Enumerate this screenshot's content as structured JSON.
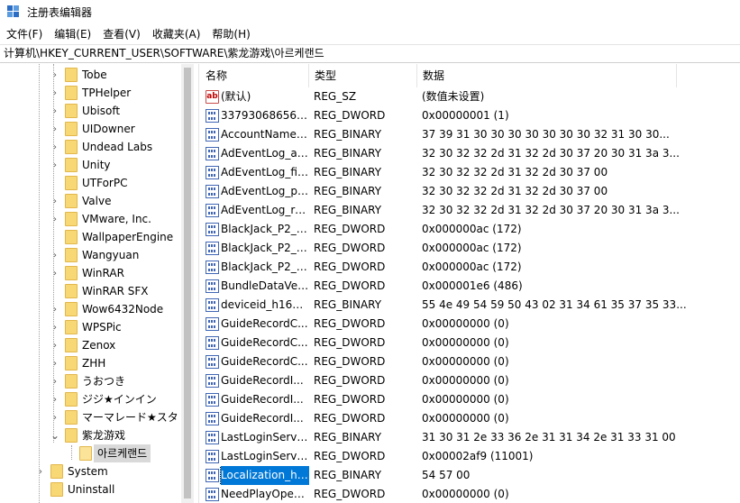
{
  "window": {
    "title": "注册表编辑器",
    "icon_name": "registry-editor-icon"
  },
  "menu": {
    "items": [
      "文件(F)",
      "编辑(E)",
      "查看(V)",
      "收藏夹(A)",
      "帮助(H)"
    ]
  },
  "address": {
    "path": "计算机\\HKEY_CURRENT_USER\\SOFTWARE\\紫龙游戏\\아르케랜드"
  },
  "tree": {
    "items": [
      {
        "label": "Tobe",
        "level": 3,
        "expandable": true
      },
      {
        "label": "TPHelper",
        "level": 3,
        "expandable": true
      },
      {
        "label": "Ubisoft",
        "level": 3,
        "expandable": true
      },
      {
        "label": "UIDowner",
        "level": 3,
        "expandable": true
      },
      {
        "label": "Undead Labs",
        "level": 3,
        "expandable": true
      },
      {
        "label": "Unity",
        "level": 3,
        "expandable": true
      },
      {
        "label": "UTForPC",
        "level": 3,
        "expandable": false
      },
      {
        "label": "Valve",
        "level": 3,
        "expandable": true
      },
      {
        "label": "VMware, Inc.",
        "level": 3,
        "expandable": true
      },
      {
        "label": "WallpaperEngine",
        "level": 3,
        "expandable": false
      },
      {
        "label": "Wangyuan",
        "level": 3,
        "expandable": true
      },
      {
        "label": "WinRAR",
        "level": 3,
        "expandable": true
      },
      {
        "label": "WinRAR SFX",
        "level": 3,
        "expandable": false
      },
      {
        "label": "Wow6432Node",
        "level": 3,
        "expandable": true
      },
      {
        "label": "WPSPic",
        "level": 3,
        "expandable": true
      },
      {
        "label": "Zenox",
        "level": 3,
        "expandable": true
      },
      {
        "label": "ZHH",
        "level": 3,
        "expandable": true
      },
      {
        "label": "うおつき",
        "level": 3,
        "expandable": true
      },
      {
        "label": "ジジ★インイン",
        "level": 3,
        "expandable": true
      },
      {
        "label": "マーマレード★スタ",
        "level": 3,
        "expandable": true
      },
      {
        "label": "紫龙游戏",
        "level": 3,
        "expandable": true,
        "expanded": true
      },
      {
        "label": "아르케랜드",
        "level": 4,
        "expandable": false,
        "selected": true
      },
      {
        "label": "System",
        "level": 2,
        "expandable": true
      },
      {
        "label": "Uninstall",
        "level": 2,
        "expandable": false
      }
    ]
  },
  "list": {
    "columns": [
      "名称",
      "类型",
      "数据"
    ],
    "rows": [
      {
        "name": "(默认)",
        "type": "REG_SZ",
        "data": "(数值未设置)",
        "icon": "string-value-icon"
      },
      {
        "name": "337930686562...",
        "type": "REG_DWORD",
        "data": "0x00000001 (1)",
        "icon": "binary-value-icon"
      },
      {
        "name": "AccountName_...",
        "type": "REG_BINARY",
        "data": "37 39 31 30 30 30 30 30 30 30 32 31 30 30...",
        "icon": "binary-value-icon"
      },
      {
        "name": "AdEventLog_ac...",
        "type": "REG_BINARY",
        "data": "32 30 32 32 2d 31 32 2d 30 37 20 30 31 3a 3...",
        "icon": "binary-value-icon"
      },
      {
        "name": "AdEventLog_fir...",
        "type": "REG_BINARY",
        "data": "32 30 32 32 2d 31 32 2d 30 37 00",
        "icon": "binary-value-icon"
      },
      {
        "name": "AdEventLog_pr...",
        "type": "REG_BINARY",
        "data": "32 30 32 32 2d 31 32 2d 30 37 00",
        "icon": "binary-value-icon"
      },
      {
        "name": "AdEventLog_re...",
        "type": "REG_BINARY",
        "data": "32 30 32 32 2d 31 32 2d 30 37 20 30 31 3a 3...",
        "icon": "binary-value-icon"
      },
      {
        "name": "BlackJack_P2_3...",
        "type": "REG_DWORD",
        "data": "0x000000ac (172)",
        "icon": "binary-value-icon"
      },
      {
        "name": "BlackJack_P2_3...",
        "type": "REG_DWORD",
        "data": "0x000000ac (172)",
        "icon": "binary-value-icon"
      },
      {
        "name": "BlackJack_P2_3...",
        "type": "REG_DWORD",
        "data": "0x000000ac (172)",
        "icon": "binary-value-icon"
      },
      {
        "name": "BundleDataVer...",
        "type": "REG_DWORD",
        "data": "0x000001e6 (486)",
        "icon": "binary-value-icon"
      },
      {
        "name": "deviceid_h160...",
        "type": "REG_BINARY",
        "data": "55 4e 49 54 59 50 43 02 31 34 61 35 37 35 33...",
        "icon": "binary-value-icon"
      },
      {
        "name": "GuideRecordC...",
        "type": "REG_DWORD",
        "data": "0x00000000 (0)",
        "icon": "binary-value-icon"
      },
      {
        "name": "GuideRecordC...",
        "type": "REG_DWORD",
        "data": "0x00000000 (0)",
        "icon": "binary-value-icon"
      },
      {
        "name": "GuideRecordC...",
        "type": "REG_DWORD",
        "data": "0x00000000 (0)",
        "icon": "binary-value-icon"
      },
      {
        "name": "GuideRecordI...",
        "type": "REG_DWORD",
        "data": "0x00000000 (0)",
        "icon": "binary-value-icon"
      },
      {
        "name": "GuideRecordI...",
        "type": "REG_DWORD",
        "data": "0x00000000 (0)",
        "icon": "binary-value-icon"
      },
      {
        "name": "GuideRecordI...",
        "type": "REG_DWORD",
        "data": "0x00000000 (0)",
        "icon": "binary-value-icon"
      },
      {
        "name": "LastLoginServe...",
        "type": "REG_BINARY",
        "data": "31 30 31 2e 33 36 2e 31 31 34 2e 31 33 31 00",
        "icon": "binary-value-icon"
      },
      {
        "name": "LastLoginServe...",
        "type": "REG_DWORD",
        "data": "0x00002af9 (11001)",
        "icon": "binary-value-icon"
      },
      {
        "name": "Localization_h1...",
        "type": "REG_BINARY",
        "data": "54 57 00",
        "icon": "binary-value-icon",
        "selected": true
      },
      {
        "name": "NeedPlayOpen...",
        "type": "REG_DWORD",
        "data": "0x00000000 (0)",
        "icon": "binary-value-icon"
      }
    ]
  },
  "colors": {
    "folder_fill": "#f8d775",
    "selection_blue": "#0078d7",
    "tree_selection": "#d9d9d9"
  }
}
